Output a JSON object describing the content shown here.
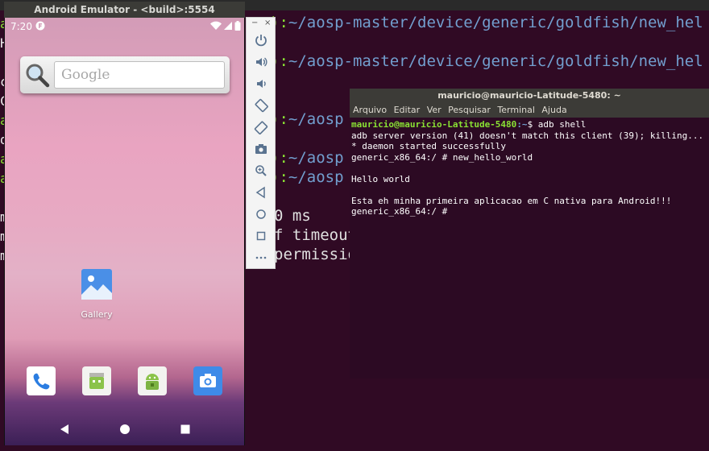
{
  "background_terminal": {
    "lines": [
      {
        "prefix": "):",
        "path": "~/aosp-master/device/generic/goldfish/new_hel"
      },
      {
        "prefix": "):",
        "path": "~/aosp-master/device/generic/goldfish/new_hel"
      },
      {
        "prefix": "):",
        "path": "~/aosp"
      },
      {
        "prefix": "):",
        "path": "~/aosp"
      },
      {
        "prefix": "):",
        "path": "~/aosp"
      }
    ],
    "fragments": [
      "0 ms",
      "f timeout",
      "permissio"
    ],
    "left_chars": [
      "a",
      "H",
      "c",
      "C",
      "a",
      "d",
      "a",
      "a",
      "m",
      "m",
      "m"
    ]
  },
  "emulator": {
    "title": "Android Emulator - <build>:5554",
    "status": {
      "time": "7:20"
    },
    "search_placeholder": "Google",
    "gallery_label": "Gallery",
    "dock": [
      "phone",
      "messages",
      "android-store",
      "camera"
    ],
    "toolbar": [
      "power",
      "volume-up",
      "volume-down",
      "rotate-left",
      "rotate-right",
      "camera",
      "zoom",
      "back",
      "home",
      "overview",
      "more"
    ],
    "toolbar_window": [
      "−",
      "×"
    ]
  },
  "terminal": {
    "title": "mauricio@mauricio-Latitude-5480: ~",
    "menu": [
      "Arquivo",
      "Editar",
      "Ver",
      "Pesquisar",
      "Terminal",
      "Ajuda"
    ],
    "prompt_user": "mauricio@mauricio-Latitude-5480",
    "prompt_path": ":~",
    "prompt_cmd": "$ adb shell",
    "output": [
      "adb server version (41) doesn't match this client (39); killing...",
      "* daemon started successfully",
      "generic_x86_64:/ # new_hello_world",
      "",
      "Hello world",
      "",
      "Esta eh minha primeira aplicacao em C nativa para Android!!!",
      "generic_x86_64:/ #"
    ]
  },
  "colors": {
    "terminal_bg": "#300a24",
    "prompt_green": "#8ae234",
    "prompt_blue": "#729fcf",
    "emulator_title": "#3b3b37"
  }
}
